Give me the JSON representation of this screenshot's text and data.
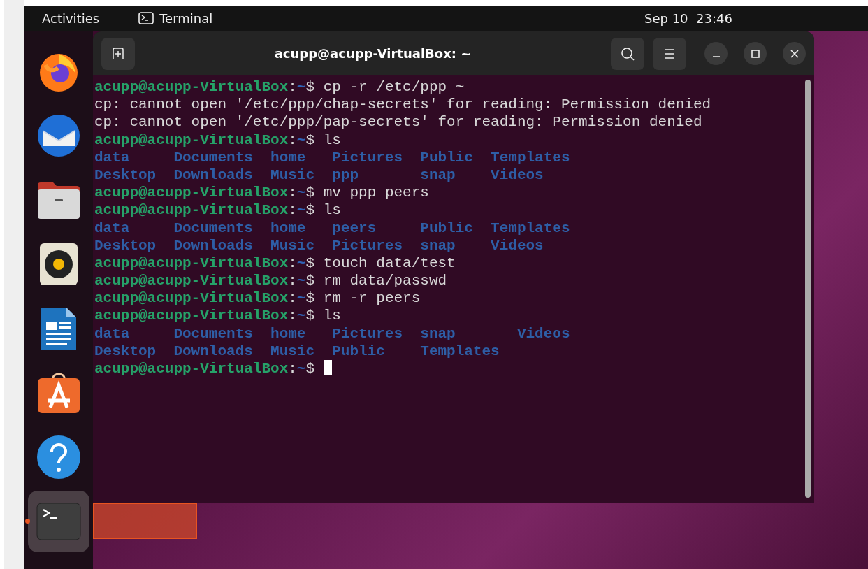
{
  "top_bar": {
    "activities": "Activities",
    "app_menu": "Terminal",
    "clock": "Sep 10  23:46"
  },
  "dock": [
    {
      "kind": "browser",
      "selected": false,
      "running": false
    },
    {
      "kind": "mail",
      "selected": false,
      "running": false
    },
    {
      "kind": "files",
      "selected": false,
      "running": false
    },
    {
      "kind": "music",
      "selected": false,
      "running": false
    },
    {
      "kind": "document",
      "selected": false,
      "running": false
    },
    {
      "kind": "store",
      "selected": false,
      "running": false
    },
    {
      "kind": "help",
      "selected": false,
      "running": false
    },
    {
      "kind": "terminal",
      "selected": true,
      "running": true
    }
  ],
  "window": {
    "title": "acupp@acupp-VirtualBox: ~"
  },
  "terminal": {
    "lines": [
      {
        "kind": "prompt",
        "user_host": "acupp@acupp-VirtualBox",
        "separator": ":",
        "path": "~",
        "symbol": "$",
        "command": "cp -r /etc/ppp ~"
      },
      {
        "kind": "output",
        "text": "cp: cannot open '/etc/ppp/chap-secrets' for reading: Permission denied"
      },
      {
        "kind": "output",
        "text": "cp: cannot open '/etc/ppp/pap-secrets' for reading: Permission denied"
      },
      {
        "kind": "prompt",
        "user_host": "acupp@acupp-VirtualBox",
        "separator": ":",
        "path": "~",
        "symbol": "$",
        "command": "ls"
      },
      {
        "kind": "listing",
        "text": "data     Documents  home   Pictures  Public  Templates"
      },
      {
        "kind": "listing",
        "text": "Desktop  Downloads  Music  ppp       snap    Videos"
      },
      {
        "kind": "prompt",
        "user_host": "acupp@acupp-VirtualBox",
        "separator": ":",
        "path": "~",
        "symbol": "$",
        "command": "mv ppp peers"
      },
      {
        "kind": "prompt",
        "user_host": "acupp@acupp-VirtualBox",
        "separator": ":",
        "path": "~",
        "symbol": "$",
        "command": "ls"
      },
      {
        "kind": "listing",
        "text": "data     Documents  home   peers     Public  Templates"
      },
      {
        "kind": "listing",
        "text": "Desktop  Downloads  Music  Pictures  snap    Videos"
      },
      {
        "kind": "prompt",
        "user_host": "acupp@acupp-VirtualBox",
        "separator": ":",
        "path": "~",
        "symbol": "$",
        "command": "touch data/test"
      },
      {
        "kind": "prompt",
        "user_host": "acupp@acupp-VirtualBox",
        "separator": ":",
        "path": "~",
        "symbol": "$",
        "command": "rm data/passwd"
      },
      {
        "kind": "prompt",
        "user_host": "acupp@acupp-VirtualBox",
        "separator": ":",
        "path": "~",
        "symbol": "$",
        "command": "rm -r peers"
      },
      {
        "kind": "prompt",
        "user_host": "acupp@acupp-VirtualBox",
        "separator": ":",
        "path": "~",
        "symbol": "$",
        "command": "ls"
      },
      {
        "kind": "listing",
        "text": "data     Documents  home   Pictures  snap       Videos"
      },
      {
        "kind": "listing",
        "text": "Desktop  Downloads  Music  Public    Templates"
      },
      {
        "kind": "prompt",
        "user_host": "acupp@acupp-VirtualBox",
        "separator": ":",
        "path": "~",
        "symbol": "$",
        "cursor": true
      }
    ]
  }
}
